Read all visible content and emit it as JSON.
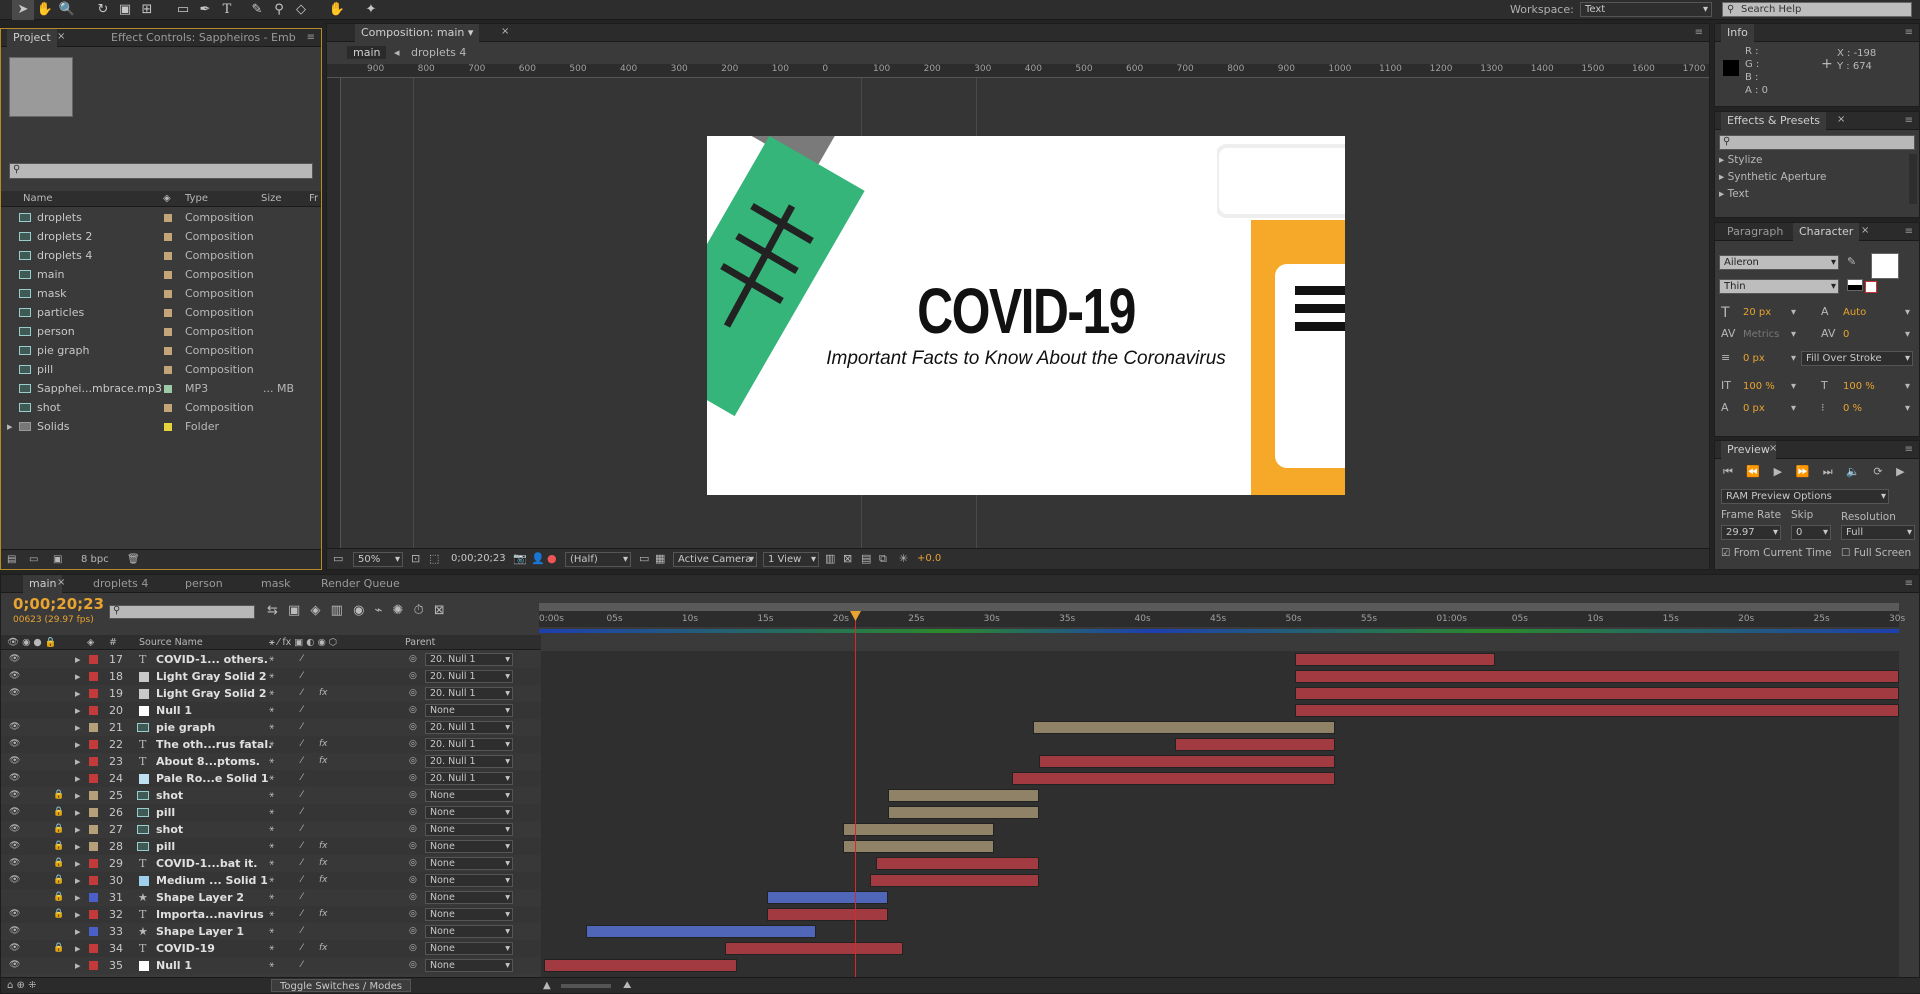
{
  "toolbar": {
    "workspace_label": "Workspace:",
    "workspace_value": "Text",
    "search_placeholder": "Search Help"
  },
  "project": {
    "tab1": "Project",
    "tab2": "Effect Controls: Sappheiros - Emb",
    "search_placeholder": "",
    "headers": {
      "name": "Name",
      "type": "Type",
      "size": "Size",
      "fr": "Fr"
    },
    "items": [
      {
        "name": "droplets",
        "type": "Composition",
        "size": "",
        "color": "#c4a57a",
        "kind": "comp"
      },
      {
        "name": "droplets 2",
        "type": "Composition",
        "size": "",
        "color": "#c4a57a",
        "kind": "comp"
      },
      {
        "name": "droplets 4",
        "type": "Composition",
        "size": "",
        "color": "#c4a57a",
        "kind": "comp"
      },
      {
        "name": "main",
        "type": "Composition",
        "size": "",
        "color": "#c4a57a",
        "kind": "comp"
      },
      {
        "name": "mask",
        "type": "Composition",
        "size": "",
        "color": "#c4a57a",
        "kind": "comp"
      },
      {
        "name": "particles",
        "type": "Composition",
        "size": "",
        "color": "#c4a57a",
        "kind": "comp"
      },
      {
        "name": "person",
        "type": "Composition",
        "size": "",
        "color": "#c4a57a",
        "kind": "comp"
      },
      {
        "name": "pie graph",
        "type": "Composition",
        "size": "",
        "color": "#c4a57a",
        "kind": "comp"
      },
      {
        "name": "pill",
        "type": "Composition",
        "size": "",
        "color": "#c4a57a",
        "kind": "comp"
      },
      {
        "name": "Sapphei...mbrace.mp3",
        "type": "MP3",
        "size": "... MB",
        "color": "#9ec9a6",
        "kind": "audio"
      },
      {
        "name": "shot",
        "type": "Composition",
        "size": "",
        "color": "#c4a57a",
        "kind": "comp"
      },
      {
        "name": "Solids",
        "type": "Folder",
        "size": "",
        "color": "#e6d23c",
        "kind": "folder"
      }
    ],
    "bpc": "8 bpc"
  },
  "comp": {
    "tab": "Composition: main",
    "crumb1": "main",
    "crumb2": "droplets 4",
    "ruler": [
      "900",
      "800",
      "700",
      "600",
      "500",
      "400",
      "300",
      "200",
      "100",
      "0",
      "100",
      "200",
      "300",
      "400",
      "500",
      "600",
      "700",
      "800",
      "900",
      "1000",
      "1100",
      "1200",
      "1300",
      "1400",
      "1500",
      "1600",
      "1700"
    ],
    "zoom": "50%",
    "timecode": "0;00;20;23",
    "resolution": "(Half)",
    "camera": "Active Camera",
    "views": "1 View",
    "exposure": "+0.0",
    "title": "COVID-19",
    "subtitle": "Important Facts to Know About the Coronavirus"
  },
  "info": {
    "tab": "Info",
    "r": "R :",
    "g": "G :",
    "b": "B :",
    "a": "A : 0",
    "x": "X : -198",
    "y": "Y : 674"
  },
  "effects": {
    "tab": "Effects & Presets",
    "items": [
      "Stylize",
      "Synthetic Aperture",
      "Text"
    ]
  },
  "character": {
    "tab1": "Paragraph",
    "tab2": "Character",
    "font": "Aileron",
    "style": "Thin",
    "size": "20 px",
    "leading": "Auto",
    "kerning": "Metrics",
    "tracking": "0",
    "stroke": "0 px",
    "stroke_mode": "Fill Over Stroke",
    "vscale": "100 %",
    "hscale": "100 %",
    "baseline": "0 px",
    "tsume": "0 %"
  },
  "preview": {
    "tab": "Preview",
    "ram": "RAM Preview Options",
    "frame_rate_label": "Frame Rate",
    "skip_label": "Skip",
    "resolution_label": "Resolution",
    "frame_rate": "29.97",
    "skip": "0",
    "resolution": "Full",
    "from_current": "From Current Time",
    "full_screen": "Full Screen"
  },
  "timeline": {
    "tabs": [
      "main",
      "droplets 4",
      "person",
      "mask",
      "Render Queue"
    ],
    "timecode": "0;00;20;23",
    "fps": "00623 (29.97 fps)",
    "col_source": "Source Name",
    "col_parent": "Parent",
    "col_num": "#",
    "ticks": [
      "0:00s",
      "05s",
      "10s",
      "15s",
      "20s",
      "25s",
      "30s",
      "35s",
      "40s",
      "45s",
      "50s",
      "55s",
      "01:00s",
      "05s",
      "10s",
      "15s",
      "20s",
      "25s",
      "30s"
    ],
    "toggle": "Toggle Switches / Modes",
    "layers": [
      {
        "num": "17",
        "name": "COVID-1... others.",
        "parent": "20. Null 1",
        "label": "#c23a3a",
        "type": "T",
        "fx": false,
        "lock": false,
        "eye": true,
        "bar": {
          "s": 50.0,
          "e": 63.2,
          "c": "#a23a42"
        }
      },
      {
        "num": "18",
        "name": "Light Gray Solid 2",
        "parent": "20. Null 1",
        "label": "#c23a3a",
        "type": "solid",
        "scol": "#c8c8c8",
        "fx": false,
        "lock": false,
        "eye": true,
        "bar": {
          "s": 50.0,
          "e": 90,
          "c": "#a23a42"
        }
      },
      {
        "num": "19",
        "name": "Light Gray Solid 2",
        "parent": "20. Null 1",
        "label": "#c23a3a",
        "type": "solid",
        "scol": "#c8c8c8",
        "fx": true,
        "lock": false,
        "eye": true,
        "bar": {
          "s": 50.0,
          "e": 90,
          "c": "#a23a42"
        }
      },
      {
        "num": "20",
        "name": "Null 1",
        "parent": "None",
        "label": "#c23a3a",
        "type": "solid",
        "scol": "#ffffff",
        "fx": false,
        "lock": false,
        "eye": false,
        "bar": {
          "s": 50.0,
          "e": 90,
          "c": "#a23a42"
        }
      },
      {
        "num": "21",
        "name": "pie graph",
        "parent": "20. Null 1",
        "label": "#b5a07a",
        "type": "comp",
        "fx": false,
        "lock": false,
        "eye": true,
        "bar": {
          "s": 32.6,
          "e": 52.6,
          "c": "#8f8266"
        }
      },
      {
        "num": "22",
        "name": "The oth...rus fatal.",
        "parent": "20. Null 1",
        "label": "#c23a3a",
        "type": "T",
        "fx": true,
        "lock": false,
        "eye": true,
        "bar": {
          "s": 42.0,
          "e": 52.6,
          "c": "#a23a42"
        }
      },
      {
        "num": "23",
        "name": "About 8...ptoms.",
        "parent": "20. Null 1",
        "label": "#c23a3a",
        "type": "T",
        "fx": true,
        "lock": false,
        "eye": true,
        "bar": {
          "s": 33.0,
          "e": 52.6,
          "c": "#a23a42"
        }
      },
      {
        "num": "24",
        "name": "Pale Ro...e Solid 1",
        "parent": "20. Null 1",
        "label": "#c23a3a",
        "type": "solid",
        "scol": "#bfe0f0",
        "fx": false,
        "lock": false,
        "eye": true,
        "bar": {
          "s": 31.2,
          "e": 52.6,
          "c": "#a23a42"
        }
      },
      {
        "num": "25",
        "name": "shot",
        "parent": "None",
        "label": "#b5a07a",
        "type": "comp",
        "fx": false,
        "lock": true,
        "eye": true,
        "bar": {
          "s": 23.0,
          "e": 33.0,
          "c": "#8f8266"
        }
      },
      {
        "num": "26",
        "name": "pill",
        "parent": "None",
        "label": "#b5a07a",
        "type": "comp",
        "fx": false,
        "lock": true,
        "eye": true,
        "bar": {
          "s": 23.0,
          "e": 33.0,
          "c": "#8f8266"
        }
      },
      {
        "num": "27",
        "name": "shot",
        "parent": "None",
        "label": "#b5a07a",
        "type": "comp",
        "fx": false,
        "lock": true,
        "eye": true,
        "bar": {
          "s": 20.0,
          "e": 30.0,
          "c": "#8f8266"
        }
      },
      {
        "num": "28",
        "name": "pill",
        "parent": "None",
        "label": "#b5a07a",
        "type": "comp",
        "fx": true,
        "lock": true,
        "eye": true,
        "bar": {
          "s": 20.0,
          "e": 30.0,
          "c": "#8f8266"
        }
      },
      {
        "num": "29",
        "name": "COVID-1...bat it.",
        "parent": "None",
        "label": "#c23a3a",
        "type": "T",
        "fx": true,
        "lock": true,
        "eye": true,
        "bar": {
          "s": 22.2,
          "e": 33.0,
          "c": "#a23a42"
        }
      },
      {
        "num": "30",
        "name": "Medium ... Solid 1",
        "parent": "None",
        "label": "#c23a3a",
        "type": "solid",
        "scol": "#9ed0ee",
        "fx": true,
        "lock": true,
        "eye": true,
        "bar": {
          "s": 21.8,
          "e": 33.0,
          "c": "#a23a42"
        }
      },
      {
        "num": "31",
        "name": "Shape Layer 2",
        "parent": "None",
        "label": "#4a5fc8",
        "type": "star",
        "fx": false,
        "lock": true,
        "eye": false,
        "bar": {
          "s": 15.0,
          "e": 23.0,
          "c": "#5066b8"
        }
      },
      {
        "num": "32",
        "name": "Importa...navirus",
        "parent": "None",
        "label": "#c23a3a",
        "type": "T",
        "fx": true,
        "lock": true,
        "eye": true,
        "bar": {
          "s": 15.0,
          "e": 23.0,
          "c": "#a23a42"
        }
      },
      {
        "num": "33",
        "name": "Shape Layer 1",
        "parent": "None",
        "label": "#4a5fc8",
        "type": "star",
        "fx": false,
        "lock": false,
        "eye": true,
        "bar": {
          "s": 3.0,
          "e": 18.2,
          "c": "#5066b8"
        }
      },
      {
        "num": "34",
        "name": "COVID-19",
        "parent": "None",
        "label": "#c23a3a",
        "type": "T",
        "fx": true,
        "lock": true,
        "eye": true,
        "bar": {
          "s": 12.2,
          "e": 24.0,
          "c": "#a23a42"
        }
      },
      {
        "num": "35",
        "name": "Null 1",
        "parent": "None",
        "label": "#c23a3a",
        "type": "solid",
        "scol": "#ffffff",
        "fx": false,
        "lock": false,
        "eye": true,
        "bar": {
          "s": 0.2,
          "e": 13.0,
          "c": "#a23a42"
        }
      }
    ]
  }
}
